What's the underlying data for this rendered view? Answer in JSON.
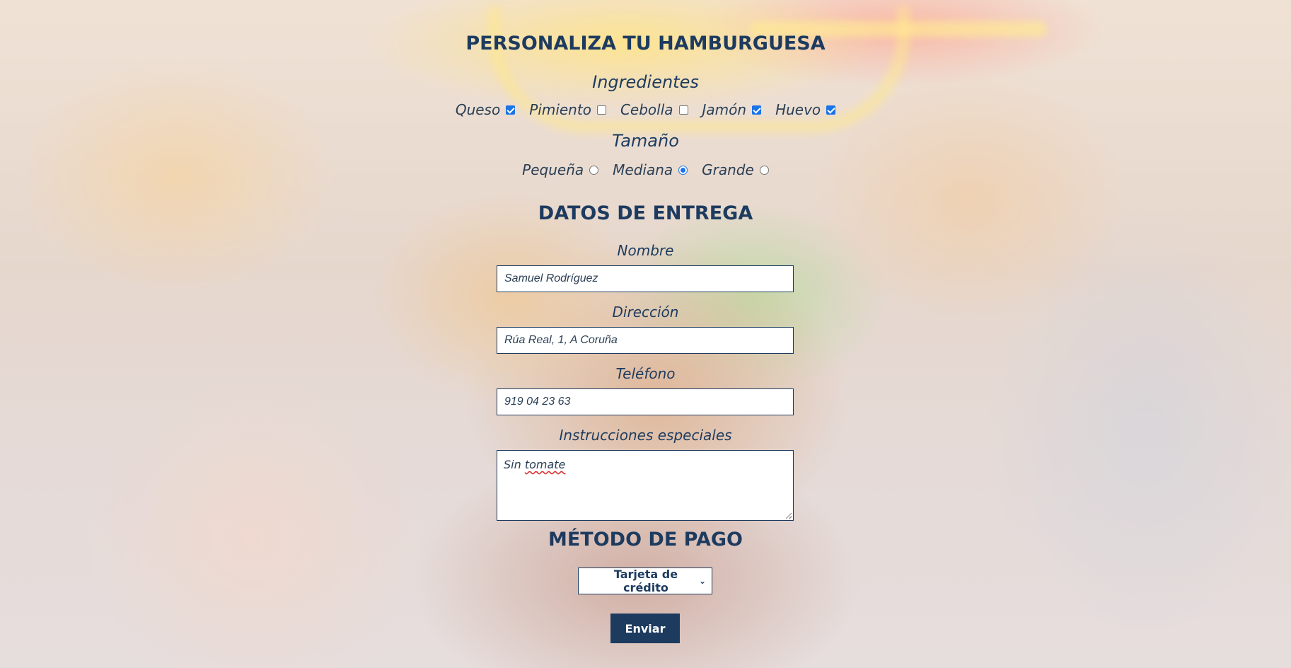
{
  "customize": {
    "title": "PERSONALIZA TU HAMBURGUESA",
    "ingredients_heading": "Ingredientes",
    "ingredients": [
      {
        "label": "Queso",
        "checked": true
      },
      {
        "label": "Pimiento",
        "checked": false
      },
      {
        "label": "Cebolla",
        "checked": false
      },
      {
        "label": "Jamón",
        "checked": true
      },
      {
        "label": "Huevo",
        "checked": true
      }
    ],
    "size_heading": "Tamaño",
    "sizes": [
      {
        "label": "Pequeña",
        "selected": false
      },
      {
        "label": "Mediana",
        "selected": true
      },
      {
        "label": "Grande",
        "selected": false
      }
    ]
  },
  "delivery": {
    "title": "DATOS DE ENTREGA",
    "name_label": "Nombre",
    "name_value": "Samuel Rodríguez",
    "address_label": "Dirección",
    "address_value": "Rúa Real, 1, A Coruña",
    "phone_label": "Teléfono",
    "phone_value": "919 04 23 63",
    "instructions_label": "Instrucciones especiales",
    "instructions_value_prefix": "Sin ",
    "instructions_value_flagged": "tomate"
  },
  "payment": {
    "title": "MÉTODO DE PAGO",
    "method_selected": "Tarjeta de crédito",
    "submit_label": "Enviar"
  },
  "colors": {
    "primary": "#1d3b5f",
    "checkbox_accent": "#1a73e8"
  },
  "icons": {
    "select_arrow": "chevron-down-icon"
  }
}
